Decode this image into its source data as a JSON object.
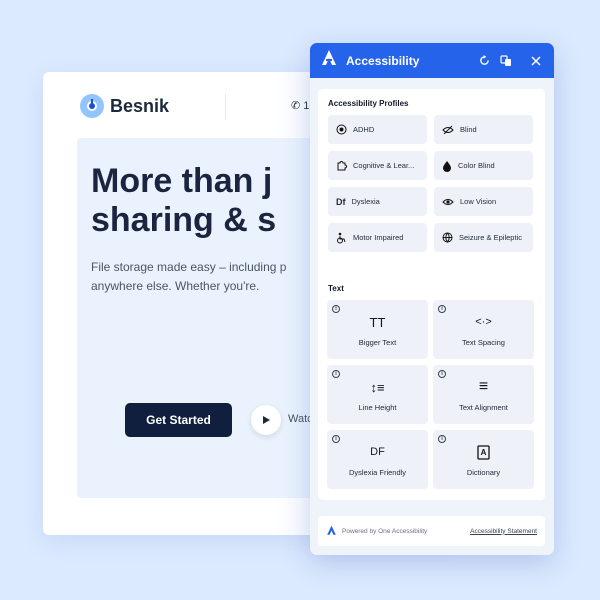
{
  "site": {
    "brand": "Besnik",
    "phone": "1-",
    "hero_line1": "More than j",
    "hero_line2": "sharing & s",
    "sub_line1": "File storage made easy – including p",
    "sub_line2": "anywhere else. Whether you're.",
    "cta": "Get Started",
    "watch": "Watc"
  },
  "panel": {
    "title": "Accessibility",
    "profiles_title": "Accessibility Profiles",
    "profiles": [
      {
        "label": "ADHD",
        "icon": "target-icon"
      },
      {
        "label": "Blind",
        "icon": "eye-off-icon"
      },
      {
        "label": "Cognitive & Lear...",
        "icon": "puzzle-icon"
      },
      {
        "label": "Color Blind",
        "icon": "droplet-icon"
      },
      {
        "label": "Dyslexia",
        "icon": "df-icon"
      },
      {
        "label": "Low Vision",
        "icon": "eye-icon"
      },
      {
        "label": "Motor Impaired",
        "icon": "wheelchair-icon"
      },
      {
        "label": "Seizure & Epileptic",
        "icon": "globe-icon"
      }
    ],
    "text_title": "Text",
    "text_tools": [
      {
        "label": "Bigger Text",
        "glyph": "TT"
      },
      {
        "label": "Text Spacing",
        "glyph": "<·>"
      },
      {
        "label": "Line Height",
        "glyph": "↕≡"
      },
      {
        "label": "Text Alignment",
        "glyph": "≡"
      },
      {
        "label": "Dyslexia Friendly",
        "glyph": "DF"
      },
      {
        "label": "Dictionary",
        "glyph": "A"
      }
    ],
    "info_glyph": "i",
    "footer_powered": "Powered by One Accessibility",
    "footer_statement": "Accessibility Statement"
  },
  "colors": {
    "accent": "#2563eb",
    "dark": "#0f1f3d",
    "bg": "#dbeafe"
  }
}
